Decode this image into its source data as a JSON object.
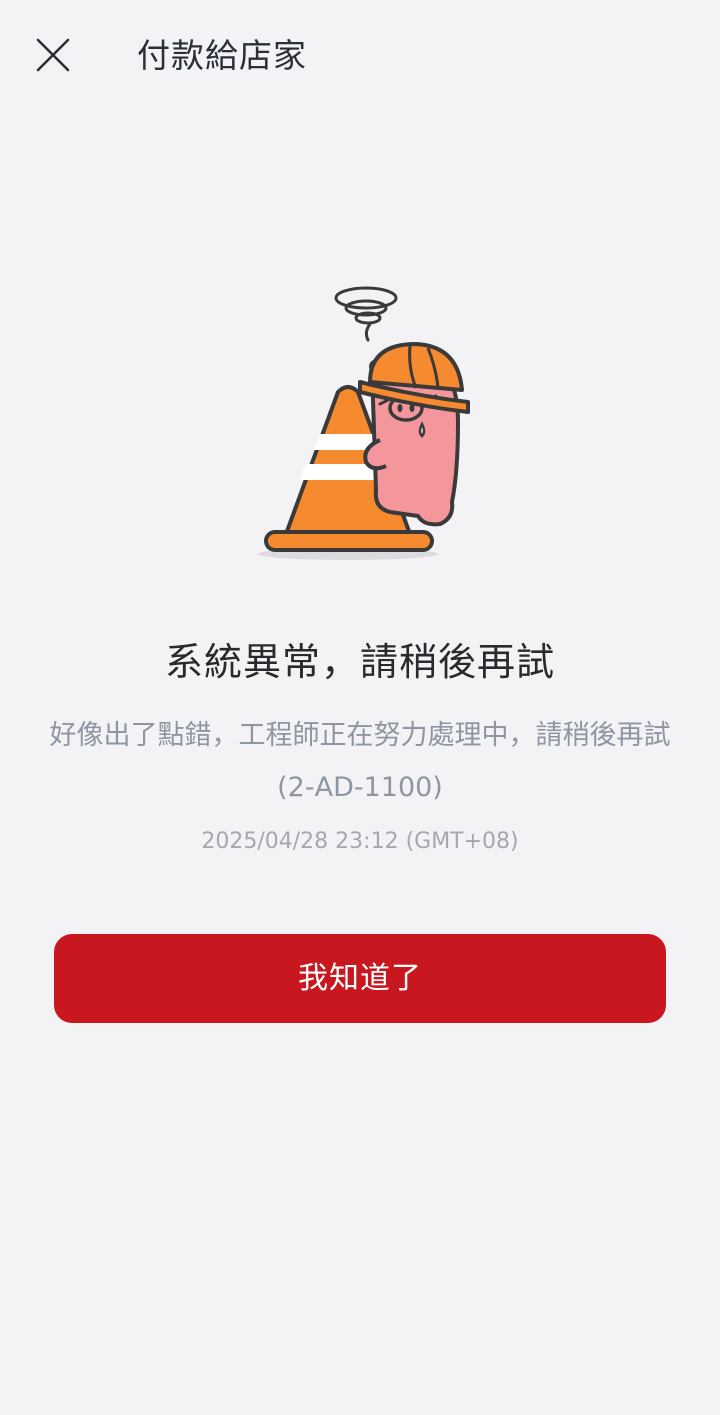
{
  "header": {
    "title": "付款給店家",
    "close_icon": "close-icon"
  },
  "error": {
    "illustration": "pig-with-traffic-cone-illustration",
    "title": "系統異常，請稍後再試",
    "description": "好像出了點錯，工程師正在努力處理中，請稍後再試 (2-AD-1100)",
    "timestamp": "2025/04/28 23:12 (GMT+08)"
  },
  "actions": {
    "confirm_label": "我知道了"
  },
  "colors": {
    "background": "#f3f3f6",
    "primary_button": "#c8171e",
    "cone": "#f58a2e",
    "pig": "#f4979c"
  }
}
